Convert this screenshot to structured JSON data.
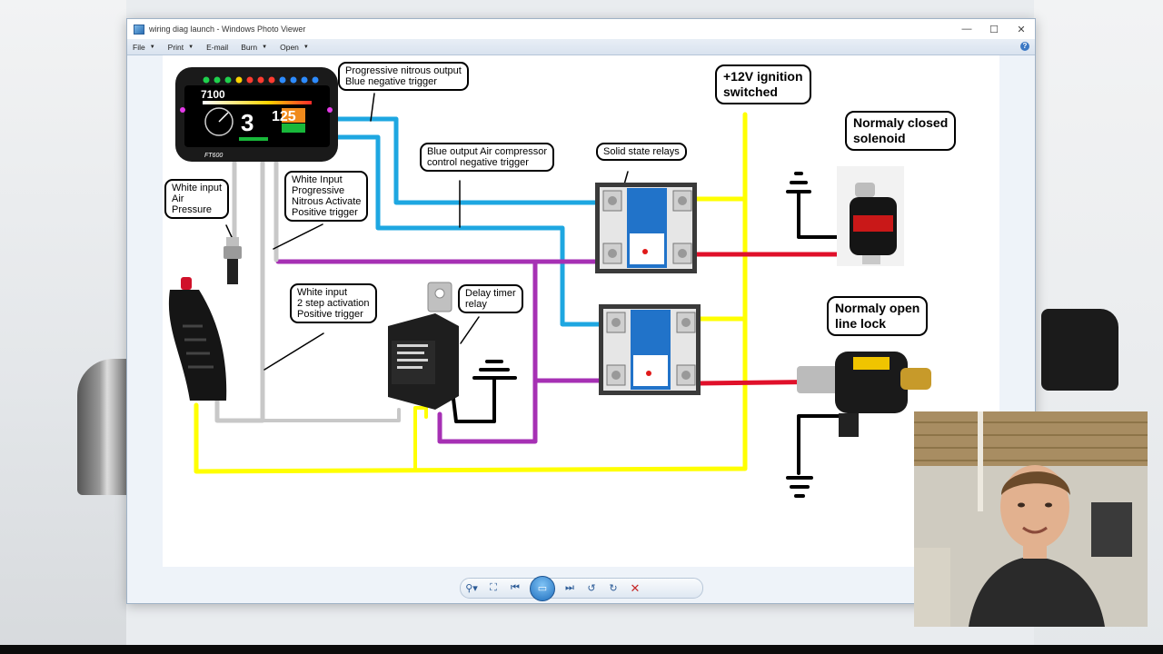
{
  "window": {
    "title": "wiring diag launch - Windows Photo Viewer",
    "controls": {
      "minimize": "—",
      "maximize": "☐",
      "close": "✕"
    }
  },
  "menu": [
    {
      "label": "File"
    },
    {
      "label": "Print"
    },
    {
      "label": "E-mail"
    },
    {
      "label": "Burn"
    },
    {
      "label": "Open"
    }
  ],
  "diagram": {
    "labels": {
      "nitrous_output": "Progressive nitrous output\nBlue negative trigger",
      "ignition": "+12V ignition\nswitched",
      "nc_solenoid": "Normaly closed\nsolenoid",
      "air_compressor": "Blue output Air compressor\ncontrol negative trigger",
      "ssr": "Solid state relays",
      "air_pressure": "White input\nAir\nPressure",
      "nitrous_activate": "White Input\nProgressive\nNitrous Activate\nPositive trigger",
      "two_step": "White input\n2 step activation\nPositive trigger",
      "delay_timer": "Delay timer\nrelay",
      "line_lock": "Normaly open\nline lock"
    },
    "dash": {
      "rpm": "7100",
      "gear": "3",
      "speed": "125",
      "brand": "FT600"
    }
  },
  "toolbar": {
    "zoom_icon": "magnifier-icon",
    "fit_icon": "actual-size-icon",
    "prev_icon": "previous-icon",
    "slideshow_icon": "slideshow-icon",
    "next_icon": "next-icon",
    "rotate_ccw_icon": "rotate-counterclockwise-icon",
    "rotate_cw_icon": "rotate-clockwise-icon",
    "delete_icon": "delete-icon"
  },
  "colors": {
    "wire_blue": "#1ea7e1",
    "wire_yellow": "#ffff00",
    "wire_purple": "#a630b4",
    "wire_red": "#e0102a",
    "wire_gray": "#c8c8c8"
  }
}
